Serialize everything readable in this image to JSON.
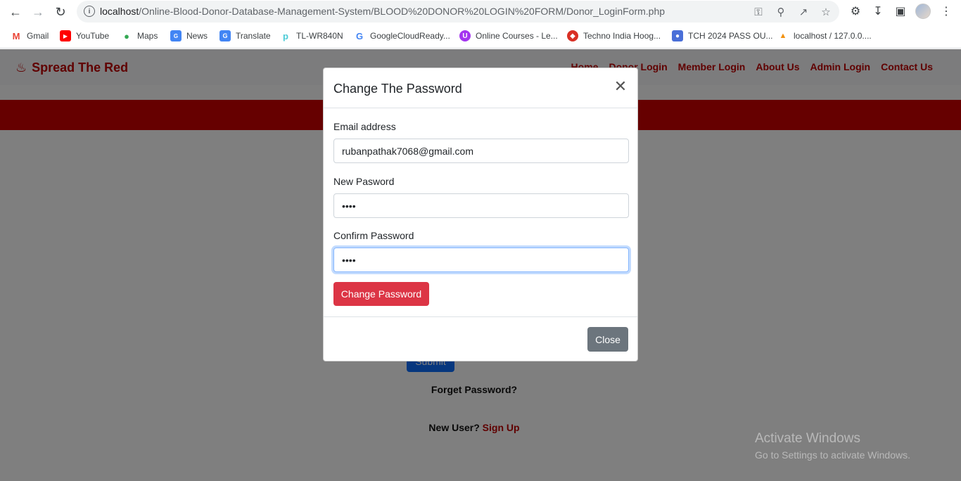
{
  "browser": {
    "url_host": "localhost",
    "url_path": "/Online-Blood-Donor-Database-Management-System/BLOOD%20DONOR%20LOGIN%20FORM/Donor_LoginForm.php",
    "bookmarks": [
      {
        "label": "Gmail",
        "icon": "gmail-icon",
        "color": "#ea4335"
      },
      {
        "label": "YouTube",
        "icon": "youtube-icon",
        "color": "#ff0000"
      },
      {
        "label": "Maps",
        "icon": "maps-icon",
        "color": "#34a853"
      },
      {
        "label": "News",
        "icon": "news-icon",
        "color": "#4285f4"
      },
      {
        "label": "Translate",
        "icon": "translate-icon",
        "color": "#4285f4"
      },
      {
        "label": "TL-WR840N",
        "icon": "tplink-icon",
        "color": "#4acbd6"
      },
      {
        "label": "GoogleCloudReady...",
        "icon": "google-icon",
        "color": "#4285f4"
      },
      {
        "label": "Online Courses - Le...",
        "icon": "courses-icon",
        "color": "#a435f0"
      },
      {
        "label": "Techno India Hoog...",
        "icon": "techno-icon",
        "color": "#d93025"
      },
      {
        "label": "TCH 2024 PASS OU...",
        "icon": "group-icon",
        "color": "#4a6fd8"
      },
      {
        "label": "localhost / 127.0.0....",
        "icon": "phpmyadmin-icon",
        "color": "#f29111"
      }
    ]
  },
  "site": {
    "brand": "Spread The Red",
    "nav": [
      "Home",
      "Donor Login",
      "Member Login",
      "About Us",
      "Admin Login",
      "Contact Us"
    ],
    "submit_label": "Submit",
    "forget_label": "Forget Password?",
    "new_user_label": "New User?",
    "signup_label": "Sign Up",
    "brand_color": "#c00000"
  },
  "modal": {
    "title": "Change The Password",
    "email_label": "Email address",
    "email_value": "rubanpathak7068@gmail.com",
    "new_password_label": "New Pasword",
    "new_password_value": "1234",
    "confirm_password_label": "Confirm Password",
    "confirm_password_value": "1234",
    "change_button": "Change Password",
    "close_button": "Close"
  },
  "watermark": {
    "title": "Activate Windows",
    "subtitle": "Go to Settings to activate Windows."
  }
}
